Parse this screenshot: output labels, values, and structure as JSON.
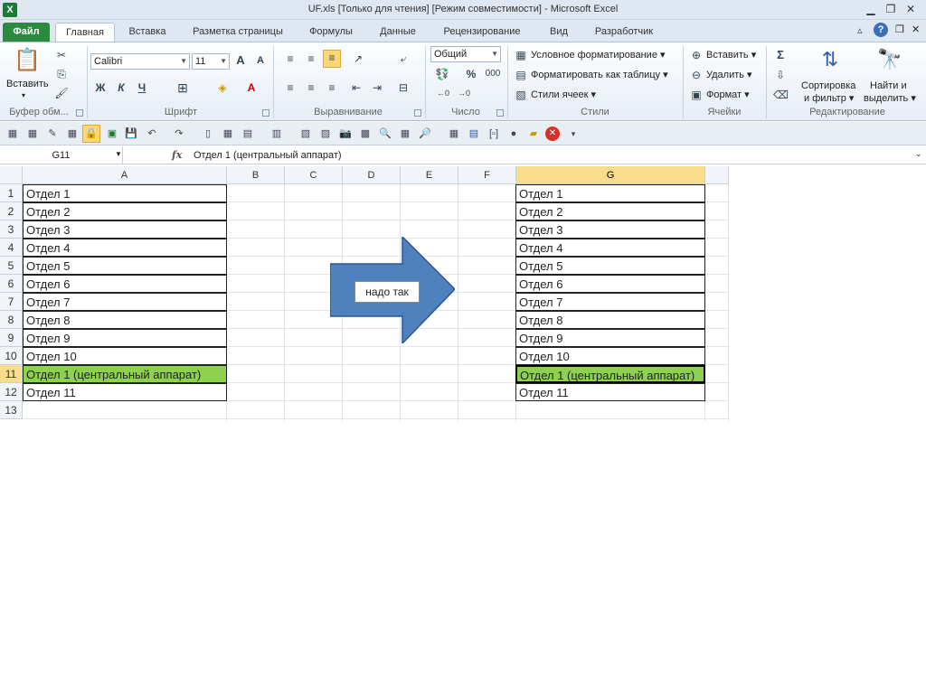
{
  "window": {
    "title": "UF.xls  [Только для чтения]  [Режим совместимости]  -  Microsoft Excel",
    "logo": "X"
  },
  "tabs": [
    {
      "label": "Файл"
    },
    {
      "label": "Главная"
    },
    {
      "label": "Вставка"
    },
    {
      "label": "Разметка страницы"
    },
    {
      "label": "Формулы"
    },
    {
      "label": "Данные"
    },
    {
      "label": "Рецензирование"
    },
    {
      "label": "Вид"
    },
    {
      "label": "Разработчик"
    }
  ],
  "ribbon": {
    "clipboard": {
      "label": "Буфер обм...",
      "paste": "Вставить"
    },
    "font": {
      "label": "Шрифт",
      "font_name": "Calibri",
      "font_size": "11",
      "bold": "Ж",
      "italic": "К",
      "underline": "Ч"
    },
    "alignment": {
      "label": "Выравнивание"
    },
    "number": {
      "label": "Число",
      "format": "Общий",
      "percent": "%",
      "thousands": "000"
    },
    "styles": {
      "label": "Стили",
      "conditional": "Условное форматирование",
      "as_table": "Форматировать как таблицу",
      "cell_styles": "Стили ячеек"
    },
    "cells": {
      "label": "Ячейки",
      "insert": "Вставить",
      "delete": "Удалить",
      "format": "Формат"
    },
    "editing": {
      "label": "Редактирование",
      "sort_1": "Сортировка",
      "sort_2": "и фильтр",
      "find_1": "Найти и",
      "find_2": "выделить",
      "sigma": "Σ"
    }
  },
  "formula_bar": {
    "name_box": "G11",
    "fx": "fx",
    "content": "Отдел 1 (центральный аппарат)"
  },
  "grid": {
    "columns": [
      "A",
      "B",
      "C",
      "D",
      "E",
      "F",
      "G"
    ],
    "selected_column": "G",
    "rows": [
      "1",
      "2",
      "3",
      "4",
      "5",
      "6",
      "7",
      "8",
      "9",
      "10",
      "11",
      "12",
      "13"
    ],
    "selected_row": "11",
    "col_a": [
      "Отдел 1",
      "Отдел 2",
      "Отдел 3",
      "Отдел 4",
      "Отдел 5",
      "Отдел 6",
      "Отдел 7",
      "Отдел 8",
      "Отдел 9",
      "Отдел 10",
      "Отдел 1 (центральный аппарат)",
      "Отдел 11"
    ],
    "col_g": [
      "Отдел 1",
      "Отдел 2",
      "Отдел 3",
      "Отдел 4",
      "Отдел 5",
      "Отдел 6",
      "Отдел 7",
      "Отдел 8",
      "Отдел 9",
      "Отдел 10",
      "Отдел 1 (центральный аппарат)",
      "Отдел 11"
    ],
    "highlight_color": "#8dd14f"
  },
  "shape": {
    "label": "надо так",
    "fill": "#4f81bd"
  }
}
